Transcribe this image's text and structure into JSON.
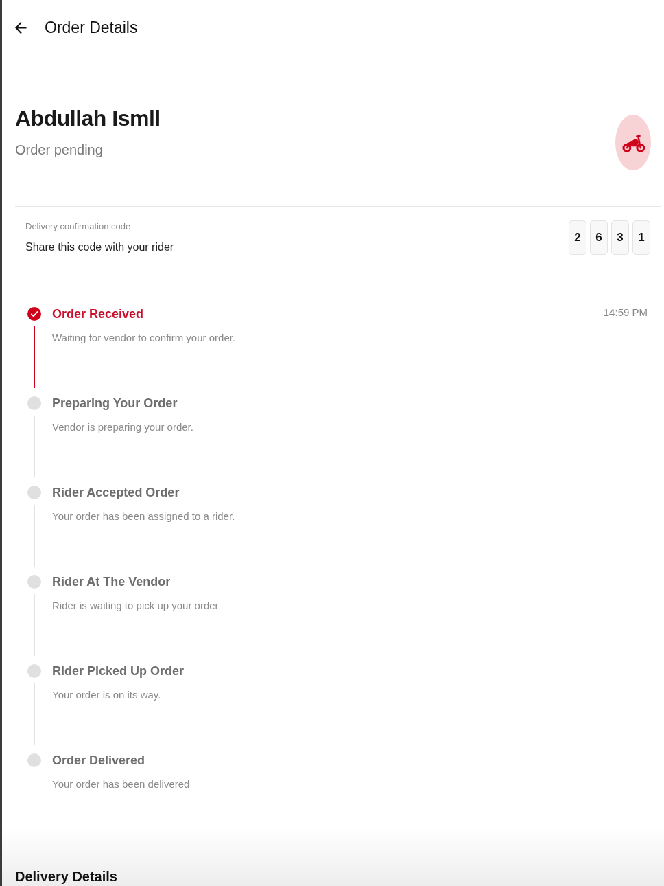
{
  "header": {
    "title": "Order Details"
  },
  "customer": {
    "name": "Abdullah Ismll",
    "status": "Order pending"
  },
  "confirmation": {
    "label": "Delivery confirmation code",
    "hint": "Share this code with your rider",
    "digits": [
      "2",
      "6",
      "3",
      "1"
    ]
  },
  "steps": [
    {
      "title": "Order Received",
      "description": "Waiting for vendor to confirm your order.",
      "time": "14:59 PM",
      "done": true
    },
    {
      "title": "Preparing Your Order",
      "description": "Vendor is preparing your order.",
      "done": false
    },
    {
      "title": "Rider Accepted Order",
      "description": "Your order has been assigned to a rider.",
      "done": false
    },
    {
      "title": "Rider At The Vendor",
      "description": "Rider is waiting to pick up your order",
      "done": false
    },
    {
      "title": "Rider Picked Up Order",
      "description": "Your order is on its way.",
      "done": false
    },
    {
      "title": "Order Delivered",
      "description": "Your order has been delivered",
      "done": false
    }
  ],
  "section": {
    "title": "Delivery Details"
  }
}
